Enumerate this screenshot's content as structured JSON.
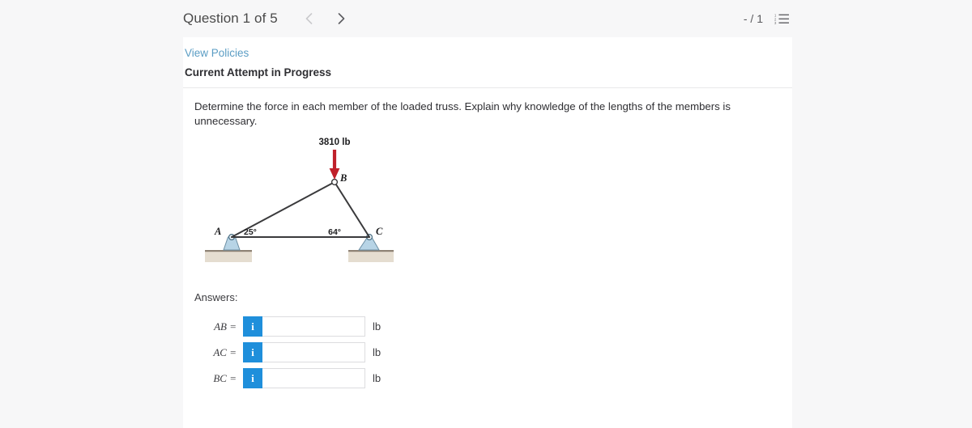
{
  "header": {
    "question_counter": "Question 1 of 5",
    "prev_icon": "chevron-left-icon",
    "prev_label": "‹",
    "next_icon": "chevron-right-icon",
    "next_label": "›",
    "score": "- / 1",
    "list_icon": "ordered-list-icon"
  },
  "card": {
    "view_policies": "View Policies",
    "attempt_status": "Current Attempt in Progress",
    "question_text": "Determine the force in each member of the loaded truss. Explain why knowledge of the lengths of the members is unnecessary."
  },
  "figure": {
    "name": "loaded-truss-diagram",
    "load_label": "3810 lb",
    "joint_a": "A",
    "joint_b": "B",
    "joint_c": "C",
    "angle_a": "25°",
    "angle_c": "64°",
    "colors": {
      "load_arrow": "#c0202a",
      "member": "#3a3a3c",
      "support_fill": "#bcd8e8",
      "support_stroke": "#5d7f93",
      "ground_fill": "#e5ddd0",
      "ground_top": "#8e8274"
    }
  },
  "answers": {
    "label": "Answers:",
    "rows": [
      {
        "name": "AB",
        "label": "AB =",
        "value": "",
        "unit": "lb",
        "info_icon": "info-icon",
        "info_glyph": "i"
      },
      {
        "name": "AC",
        "label": "AC =",
        "value": "",
        "unit": "lb",
        "info_icon": "info-icon",
        "info_glyph": "i"
      },
      {
        "name": "BC",
        "label": "BC =",
        "value": "",
        "unit": "lb",
        "info_icon": "info-icon",
        "info_glyph": "i"
      }
    ]
  }
}
